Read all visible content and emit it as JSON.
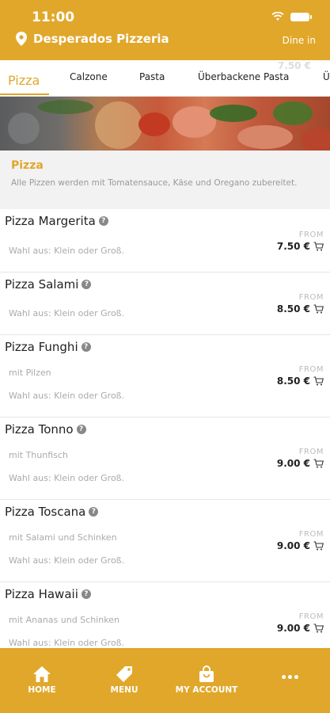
{
  "status": {
    "time": "11:00"
  },
  "header": {
    "store_name": "Desperados Pizzeria",
    "mode": "Dine in"
  },
  "tabs": {
    "ghost_price": "7.50 €",
    "items": [
      "Pizza",
      "Calzone",
      "Pasta",
      "Überbackene Pasta",
      "Ü"
    ]
  },
  "category": {
    "title": "Pizza",
    "description": "Alle Pizzen werden mit Tomatensauce, Käse und Oregano zubereitet."
  },
  "info_mark": "?",
  "from_label": "FROM",
  "items": [
    {
      "name": "Pizza Margerita",
      "detail": "",
      "option": "Wahl aus: Klein oder Groß.",
      "price": "7.50 €"
    },
    {
      "name": "Pizza Salami",
      "detail": "",
      "option": "Wahl aus: Klein oder Groß.",
      "price": "8.50 €"
    },
    {
      "name": "Pizza Funghi",
      "detail": "mit Pilzen",
      "option": "Wahl aus: Klein oder Groß.",
      "price": "8.50 €"
    },
    {
      "name": "Pizza Tonno",
      "detail": "mit Thunfisch",
      "option": "Wahl aus: Klein oder Groß.",
      "price": "9.00 €"
    },
    {
      "name": "Pizza Toscana",
      "detail": "mit Salami und Schinken",
      "option": "Wahl aus: Klein oder Groß.",
      "price": "9.00 €"
    },
    {
      "name": "Pizza Hawaii",
      "detail": "mit Ananas und Schinken",
      "option": "Wahl aus: Klein oder Groß.",
      "price": "9.00 €"
    }
  ],
  "nav": {
    "home": "HOME",
    "menu": "MENU",
    "account": "MY ACCOUNT",
    "more": "•••"
  },
  "colors": {
    "accent": "#e1a72a",
    "text": "#222222",
    "muted": "#aaaaaa"
  },
  "icons": [
    "location-pin-icon",
    "wifi-icon",
    "battery-icon",
    "info-icon",
    "cart-icon",
    "home-icon",
    "tag-icon",
    "bag-icon",
    "more-icon"
  ]
}
